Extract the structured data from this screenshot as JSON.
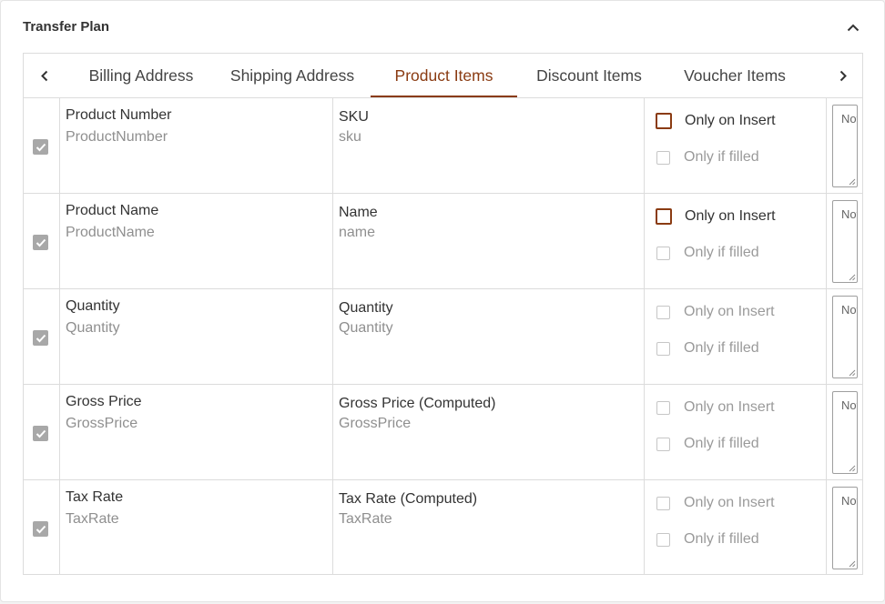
{
  "card": {
    "title": "Transfer Plan",
    "collapse_icon": "chevron-up-icon"
  },
  "tabs": {
    "prev_icon": "chevron-left-icon",
    "next_icon": "chevron-right-icon",
    "items": [
      {
        "label": "Billing Address",
        "active": false
      },
      {
        "label": "Shipping Address",
        "active": false
      },
      {
        "label": "Product Items",
        "active": true
      },
      {
        "label": "Discount Items",
        "active": false
      },
      {
        "label": "Voucher Items",
        "active": false
      }
    ],
    "accent_color": "#8a3b12"
  },
  "rows": [
    {
      "checked": true,
      "source": {
        "label": "Product Number",
        "key": "ProductNumber"
      },
      "target": {
        "label": "SKU",
        "key": "sku"
      },
      "only_on_insert": {
        "label": "Only on Insert",
        "highlighted": true
      },
      "only_if_filled": {
        "label": "Only if filled",
        "highlighted": false
      },
      "note": "Note"
    },
    {
      "checked": true,
      "source": {
        "label": "Product Name",
        "key": "ProductName"
      },
      "target": {
        "label": "Name",
        "key": "name"
      },
      "only_on_insert": {
        "label": "Only on Insert",
        "highlighted": true
      },
      "only_if_filled": {
        "label": "Only if filled",
        "highlighted": false
      },
      "note": "Note"
    },
    {
      "checked": true,
      "source": {
        "label": "Quantity",
        "key": "Quantity"
      },
      "target": {
        "label": "Quantity",
        "key": "Quantity"
      },
      "only_on_insert": {
        "label": "Only on Insert",
        "highlighted": false
      },
      "only_if_filled": {
        "label": "Only if filled",
        "highlighted": false
      },
      "note": "Note"
    },
    {
      "checked": true,
      "source": {
        "label": "Gross Price",
        "key": "GrossPrice"
      },
      "target": {
        "label": "Gross Price (Computed)",
        "key": "GrossPrice"
      },
      "only_on_insert": {
        "label": "Only on Insert",
        "highlighted": false
      },
      "only_if_filled": {
        "label": "Only if filled",
        "highlighted": false
      },
      "note": "Note"
    },
    {
      "checked": true,
      "source": {
        "label": "Tax Rate",
        "key": "TaxRate"
      },
      "target": {
        "label": "Tax Rate (Computed)",
        "key": "TaxRate"
      },
      "only_on_insert": {
        "label": "Only on Insert",
        "highlighted": false
      },
      "only_if_filled": {
        "label": "Only if filled",
        "highlighted": false
      },
      "note": "Note"
    }
  ]
}
